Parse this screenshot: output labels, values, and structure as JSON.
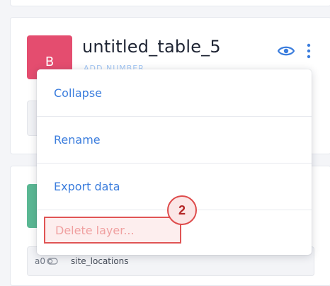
{
  "colors": {
    "layer_badge": "#e44d6f",
    "green_badge": "#5bb894",
    "accent": "#3b7ddd",
    "danger": "#e05454"
  },
  "layer": {
    "badge_letter": "B",
    "title": "untitled_table_5",
    "subtitle": "ADD NUMBER"
  },
  "menu": {
    "items": [
      {
        "label": "Collapse"
      },
      {
        "label": "Rename"
      },
      {
        "label": "Export data"
      },
      {
        "label": "Delete layer..."
      }
    ]
  },
  "step_marker": "2",
  "field": {
    "type": "a0",
    "name": "site_locations"
  }
}
